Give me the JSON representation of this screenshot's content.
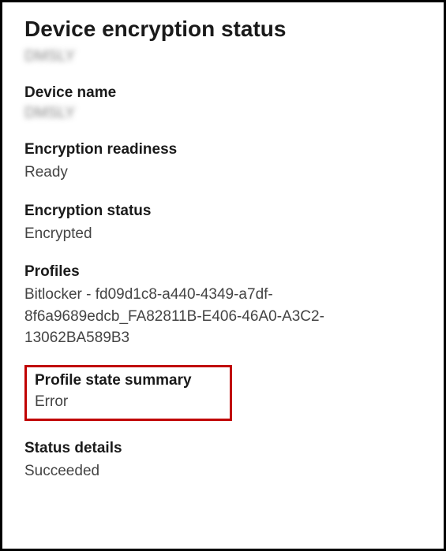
{
  "title": "Device encryption status",
  "subtitle_blurred": "DMSLY",
  "device_name": {
    "label": "Device name",
    "value_blurred": "DMSLY"
  },
  "encryption_readiness": {
    "label": "Encryption readiness",
    "value": "Ready"
  },
  "encryption_status": {
    "label": "Encryption status",
    "value": "Encrypted"
  },
  "profiles": {
    "label": "Profiles",
    "value": "Bitlocker - fd09d1c8-a440-4349-a7df-8f6a9689edcb_FA82811B-E406-46A0-A3C2-13062BA589B3"
  },
  "profile_state_summary": {
    "label": "Profile state summary",
    "value": "Error"
  },
  "status_details": {
    "label": "Status details",
    "value": "Succeeded"
  },
  "colors": {
    "highlight_border": "#c00000"
  }
}
